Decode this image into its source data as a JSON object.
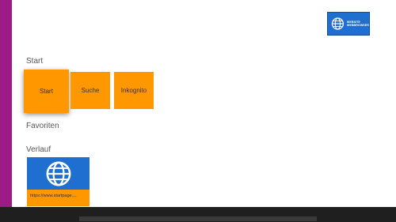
{
  "logo": {
    "text_line1": "WEBSITE",
    "text_line2": "WEBBROWSER",
    "color": "#1f6fd0"
  },
  "sections": {
    "start": "Start",
    "favorites": "Favoriten",
    "history": "Verlauf"
  },
  "tiles": [
    {
      "label": "Start",
      "focused": true
    },
    {
      "label": "Suche",
      "focused": false
    },
    {
      "label": "Inkognito",
      "focused": false
    }
  ],
  "history": {
    "items": [
      {
        "url": "https://www.startpage....",
        "icon": "globe-icon"
      }
    ]
  },
  "colors": {
    "accent_bar": "#9c1b86",
    "tile": "#ff9800",
    "thumb": "#1f6fd0"
  }
}
